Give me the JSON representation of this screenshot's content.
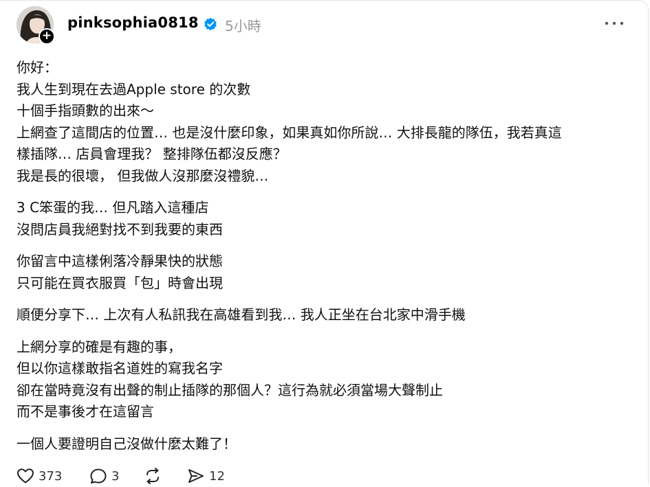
{
  "post": {
    "username": "pinksophia0818",
    "time": "5小時",
    "paragraphs": [
      [
        "你好：",
        "我人生到現在去過Apple store 的次數",
        "十個手指頭數的出來～",
        "上網查了這間店的位置… 也是沒什麼印象，如果真如你所說… 大排長龍的隊伍，我若真這",
        "樣插隊… 店員會理我？ 整排隊伍都沒反應？",
        "我是長的很壞， 但我做人沒那麼沒禮貌…"
      ],
      [
        "3 C笨蛋的我… 但凡踏入這種店",
        "沒問店員我絕對找不到我要的東西"
      ],
      [
        "你留言中這樣俐落冷靜果快的狀態",
        "只可能在買衣服買「包」時會出現"
      ],
      [
        "順便分享下… 上次有人私訊我在高雄看到我… 我人正坐在台北家中滑手機"
      ],
      [
        "上網分享的確是有趣的事，",
        "但以你這樣敢指名道姓的寫我名字",
        "卻在當時竟沒有出聲的制止插隊的那個人？這行為就必須當場大聲制止",
        "而不是事後才在這留言"
      ],
      [
        "一個人要證明自己沒做什麼太難了！"
      ]
    ]
  },
  "actions": {
    "like_count": "373",
    "comment_count": "3",
    "share_count": "12"
  },
  "icons": {
    "verified": "verified-badge-icon",
    "more": "more-dots-icon",
    "like": "heart-icon",
    "comment": "comment-bubble-icon",
    "repost": "repost-icon",
    "share": "send-icon"
  },
  "colors": {
    "verified_blue": "#0095f6",
    "muted": "#999999"
  }
}
